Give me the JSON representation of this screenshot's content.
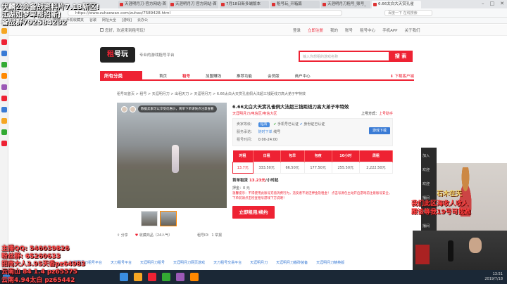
{
  "browser": {
    "tabs": [
      "天涯明月刀-官方网站-首",
      "天涯明月刀 官方网站-首",
      "7月18日新多端版本",
      "租号玩_开箱篇",
      "天涯明月刀租号_账号_",
      "6.66太白大天赏孔雀"
    ],
    "url": "https://www.zuhaowan.com/zuhao/7589428.html",
    "search_placeholder": "百度一下 在线搜索",
    "bookmarks": [
      "收藏",
      "手机收藏夹",
      "谷歌",
      "网址大全",
      "[游戏]",
      "云办公"
    ]
  },
  "site": {
    "greeting": "您好，欢迎来到租号玩！",
    "toplinks": [
      "登录",
      "立即注册",
      "我的",
      "账号",
      "租号中心",
      "手机APP",
      "关于我们"
    ],
    "logo_text_1": "租",
    "logo_text_2": "号玩",
    "slogan": "专业的游戏租号平台",
    "search_placeholder": "输入你想租的游戏名称",
    "search_btn": "搜 索",
    "category_btn": "所有分类",
    "nav": [
      "首页",
      "租号",
      "加盟赚钱",
      "推荐功能",
      "会员版",
      "商户中心"
    ],
    "nav_active_index": 1,
    "nav_right": "下载客户端"
  },
  "breadcrumb": "租号玩首页 > 租号 > 天涯明月刀 > 出租天刀 > 天涯明月刀 > 6.66太白大天赏孔雀侗大法超三钱距线刀高大弟子牢特效",
  "media": {
    "bubble": "数据卖家可以享受优惠价，简单下单请快点注意查看",
    "actions": [
      "分享",
      "收藏商品（24人气）"
    ],
    "position": "租号ID：1 举报"
  },
  "product": {
    "title": "6.66太白大天赏孔雀侗大法超三钱距线刀高大弟子牢特效",
    "subtitle": "天涯明月刀/电信区/电信大区",
    "num_label": "上号方式：",
    "num_value": "上号助手",
    "info": {
      "seller_label": "卖家等级：",
      "seller_tag": "钻石",
      "phone": "手机号已认证",
      "id_verify": "身份证已认证",
      "service_label": "服务承诺：",
      "service_value": "随时下单",
      "service_note": "线号",
      "time_label": "租号时间：",
      "time_value": "0:00-24:00"
    },
    "chat_btn": "游戏下载",
    "rent_headers": [
      "时租",
      "日租",
      "包早",
      "包夜",
      "10小时",
      "周租"
    ],
    "rent_values": [
      "13.7元",
      "333.50元",
      "66.50元",
      "177.50元",
      "255.50元",
      "2,222.50元"
    ],
    "discount_label": "首单租赁",
    "discount_value": "13.23元",
    "discount_unit": "/小时起",
    "deposit": "押金：0 元",
    "warning": "温馨提示：不得使用此账号充值消费行为，违反者不退还押金及租金！ 点击号源包主动开启游戏前注意账号安全，下单前请点击检查租号游戏下方说明！",
    "rent_btn": "立即租用/续约"
  },
  "right_strip": [
    "加入",
    "欢迎",
    "欢迎",
    "播间",
    "欢迎",
    "播间"
  ],
  "footer_links": [
    "天涯明月刀租号平台",
    "天刀租号平台",
    "天涯明月刀租号",
    "天涯明月刀网页游戏",
    "天刀租号交易平台",
    "天涯明月刀",
    "天涯明月刀搬砖装备",
    "天涯明月刀精英版"
  ],
  "clock": {
    "time": "13:51",
    "date": "2019/7/18"
  },
  "overlay": {
    "line1": "伏麟公会备战资料片7.13新区!",
    "line2": "江湖如梦卑帮招新!",
    "line3": "备战群792584232",
    "bl1": "主播QQ: 546039826",
    "bl2": "粉丝群: 65260633",
    "bl3": "招商大人3.95天香pz64983",
    "bl4": "云南山 84 1.4 pz65575",
    "bl5": "云南4.94太白 pz65442",
    "r1": "石木在天",
    "r2": "我们此区海收人收人",
    "r3": "跟该等我19号可找她"
  },
  "colors": {
    "accent": "#ee2233",
    "link": "#3a7bd5"
  }
}
